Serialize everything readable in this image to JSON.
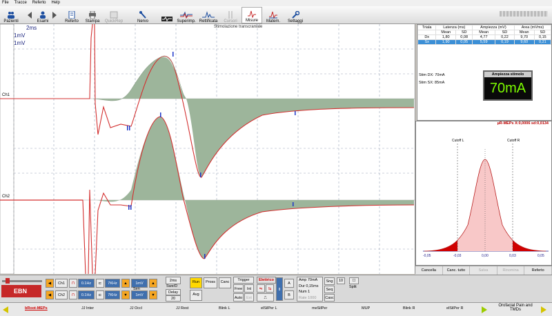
{
  "menu": [
    "File",
    "Tracce",
    "Referto",
    "Help"
  ],
  "toolbar": [
    {
      "label": "Pazienti",
      "icon": "patients-icon",
      "active": false,
      "disabled": false
    },
    {
      "label": "Esami",
      "icon": "exams-icon",
      "active": false,
      "disabled": false
    },
    {
      "label": "Referto",
      "icon": "report-icon",
      "active": false,
      "disabled": false
    },
    {
      "label": "Stampa",
      "icon": "print-icon",
      "active": false,
      "disabled": false
    },
    {
      "label": "QuickRep",
      "icon": "quickrep-icon",
      "active": false,
      "disabled": true
    },
    {
      "label": "Nervo",
      "icon": "nerve-icon",
      "active": false,
      "disabled": false
    },
    {
      "label": "",
      "icon": "wave-icon",
      "active": false,
      "disabled": false
    },
    {
      "label": "Superimp.",
      "icon": "superimpose-icon",
      "active": false,
      "disabled": false
    },
    {
      "label": "Rettificata",
      "icon": "rectified-icon",
      "active": false,
      "disabled": false
    },
    {
      "label": "Cursori",
      "icon": "cursors-icon",
      "active": false,
      "disabled": true
    },
    {
      "label": "Misure",
      "icon": "measures-icon",
      "active": true,
      "disabled": false
    },
    {
      "label": "Matem.",
      "icon": "math-icon",
      "active": false,
      "disabled": false
    },
    {
      "label": "Settaggi",
      "icon": "settings-icon",
      "active": false,
      "disabled": false
    }
  ],
  "plot": {
    "time_scale": "2ms",
    "scale_ch1": "1mV",
    "scale_ch2": "1mV",
    "title": "Stimolazione transcraniale",
    "ch1_label": "Ch1",
    "ch2_label": "Ch2",
    "fill_color": "#9db59b",
    "trace_color": "#d32f2f",
    "marker_color": "#1a33c8"
  },
  "results": {
    "group_headers": [
      "Triala",
      "Latenza (ms)",
      "Ampiezza (mV)",
      "Area (mVms)"
    ],
    "sub_headers": [
      "",
      "Mean",
      "SD",
      "Mean",
      "SD",
      "Mean",
      "SD"
    ],
    "rows": [
      {
        "name": "Dx",
        "values": [
          "1,80",
          "0,08",
          "4,77",
          "0,22",
          "9,70",
          "0,15"
        ],
        "selected": false
      },
      {
        "name": "Sx",
        "values": [
          "1,90",
          "0,05",
          "5,59",
          "0,19",
          "9,60",
          "0,21"
        ],
        "selected": true
      }
    ],
    "stim_dx": "Stim DX: 70mA",
    "stim_sx": "Stim SX: 85mA"
  },
  "amp_box": {
    "title": "Ampiezza stimolo",
    "value": "70mA"
  },
  "gauss": {
    "title": "µR-MEPs X:0,0006 sd:0,0134",
    "cutoff_l": "Cutoff L",
    "cutoff_r": "Cutoff R",
    "ticks": [
      "-0,05",
      "-0,03",
      "0,00",
      "0,03",
      "0,05"
    ]
  },
  "right_buttons": [
    {
      "label": "Cancella",
      "disabled": false
    },
    {
      "label": "Canc. tutto",
      "disabled": false
    },
    {
      "label": "Salva",
      "disabled": true
    },
    {
      "label": "Rinomina",
      "disabled": true
    },
    {
      "label": "Referto",
      "disabled": false
    }
  ],
  "controls": {
    "brand": "EBN",
    "ch1": "Ch1",
    "ch2": "Ch2",
    "lowcut": "0.1Hz",
    "highcut": "7KHz",
    "sens": "1mV",
    "sweep": "2ms",
    "sweep_label": "Swe/D",
    "sens_label": "Sen",
    "delay_label": "Delay",
    "delay_val": "20",
    "run": "Run",
    "avg": "Avg",
    "avg_val": "Σ",
    "process": "Pross",
    "cancel": "Canc",
    "trigger": "Trigger",
    "free": "Free",
    "int": "Int",
    "auto": "Auto",
    "ext": "Ext",
    "stim_type": "Elettrico",
    "amp_label": "Amp",
    "amp_val": "70mA",
    "dur_label": "Dur",
    "dur_val": "0,15ms",
    "num_label": "Num",
    "num_val": "1",
    "rate_label": "Rate",
    "rate_val": "1000",
    "sng": "Sng",
    "seq": "Seq",
    "casc": "Casc",
    "count": "10",
    "split": "Split"
  },
  "bottom_tabs": [
    {
      "label": "bRoot-MEPs",
      "active": true
    },
    {
      "label": "JJ Inter",
      "active": false
    },
    {
      "label": "JJ Occl",
      "active": false
    },
    {
      "label": "JJ Rest",
      "active": false
    },
    {
      "label": "Blink L",
      "active": false
    },
    {
      "label": "elSilPer L",
      "active": false
    },
    {
      "label": "meSilPer",
      "active": false
    },
    {
      "label": "MUP",
      "active": false
    },
    {
      "label": "Blink R",
      "active": false
    },
    {
      "label": "elSilPer R",
      "active": false
    }
  ],
  "bottom_right": "Orofacial Pain and TMDs"
}
